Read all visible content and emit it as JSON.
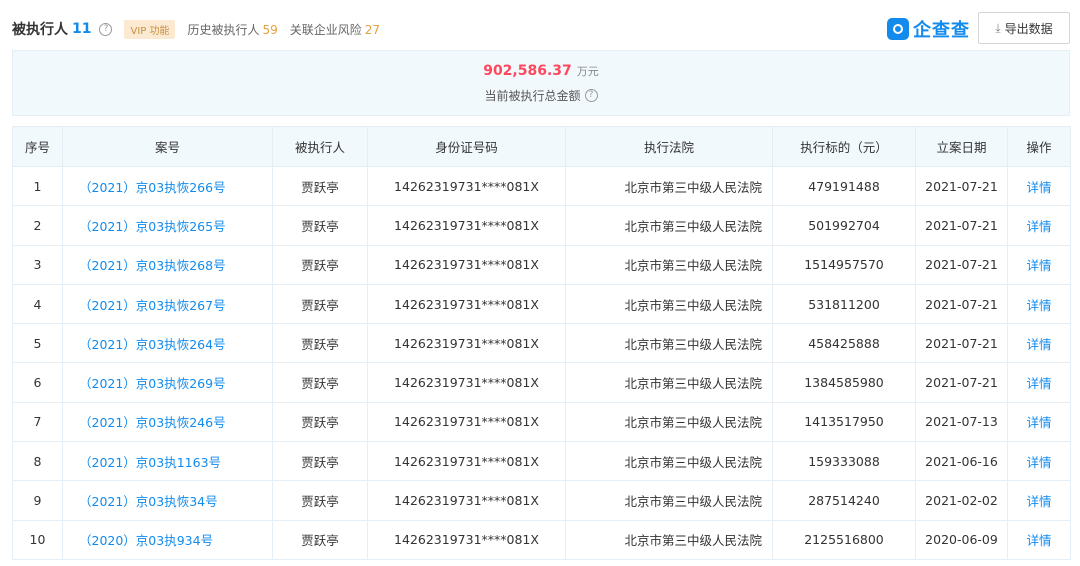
{
  "header": {
    "title": "被执行人",
    "count": "11",
    "vip_label": "VIP 功能",
    "history_label": "历史被执行人",
    "history_count": "59",
    "risk_label": "关联企业风险",
    "risk_count": "27",
    "brand": "企查查",
    "export_label": "导出数据"
  },
  "summary": {
    "amount": "902,586.37",
    "unit": "万元",
    "caption": "当前被执行总金额"
  },
  "table": {
    "columns": [
      "序号",
      "案号",
      "被执行人",
      "身份证号码",
      "执行法院",
      "执行标的（元）",
      "立案日期",
      "操作"
    ],
    "rows": [
      {
        "idx": "1",
        "case": "（2021）京03执恢266号",
        "person": "贾跃亭",
        "id": "14262319731****081X",
        "court": "北京市第三中级人民法院",
        "amount": "479191488",
        "date": "2021-07-21",
        "action": "详情"
      },
      {
        "idx": "2",
        "case": "（2021）京03执恢265号",
        "person": "贾跃亭",
        "id": "14262319731****081X",
        "court": "北京市第三中级人民法院",
        "amount": "501992704",
        "date": "2021-07-21",
        "action": "详情"
      },
      {
        "idx": "3",
        "case": "（2021）京03执恢268号",
        "person": "贾跃亭",
        "id": "14262319731****081X",
        "court": "北京市第三中级人民法院",
        "amount": "1514957570",
        "date": "2021-07-21",
        "action": "详情"
      },
      {
        "idx": "4",
        "case": "（2021）京03执恢267号",
        "person": "贾跃亭",
        "id": "14262319731****081X",
        "court": "北京市第三中级人民法院",
        "amount": "531811200",
        "date": "2021-07-21",
        "action": "详情"
      },
      {
        "idx": "5",
        "case": "（2021）京03执恢264号",
        "person": "贾跃亭",
        "id": "14262319731****081X",
        "court": "北京市第三中级人民法院",
        "amount": "458425888",
        "date": "2021-07-21",
        "action": "详情"
      },
      {
        "idx": "6",
        "case": "（2021）京03执恢269号",
        "person": "贾跃亭",
        "id": "14262319731****081X",
        "court": "北京市第三中级人民法院",
        "amount": "1384585980",
        "date": "2021-07-21",
        "action": "详情"
      },
      {
        "idx": "7",
        "case": "（2021）京03执恢246号",
        "person": "贾跃亭",
        "id": "14262319731****081X",
        "court": "北京市第三中级人民法院",
        "amount": "1413517950",
        "date": "2021-07-13",
        "action": "详情"
      },
      {
        "idx": "8",
        "case": "（2021）京03执1163号",
        "person": "贾跃亭",
        "id": "14262319731****081X",
        "court": "北京市第三中级人民法院",
        "amount": "159333088",
        "date": "2021-06-16",
        "action": "详情"
      },
      {
        "idx": "9",
        "case": "（2021）京03执恢34号",
        "person": "贾跃亭",
        "id": "14262319731****081X",
        "court": "北京市第三中级人民法院",
        "amount": "287514240",
        "date": "2021-02-02",
        "action": "详情"
      },
      {
        "idx": "10",
        "case": "（2020）京03执934号",
        "person": "贾跃亭",
        "id": "14262319731****081X",
        "court": "北京市第三中级人民法院",
        "amount": "2125516800",
        "date": "2020-06-09",
        "action": "详情"
      }
    ]
  },
  "colors": {
    "accent": "#128bed",
    "amount": "#fd485e",
    "count_orange": "#e2a13f",
    "header_bg": "#f2f9fd"
  },
  "icons": {
    "help": "question-circle-icon",
    "export": "download-icon",
    "brand": "qcc-logo-icon"
  }
}
